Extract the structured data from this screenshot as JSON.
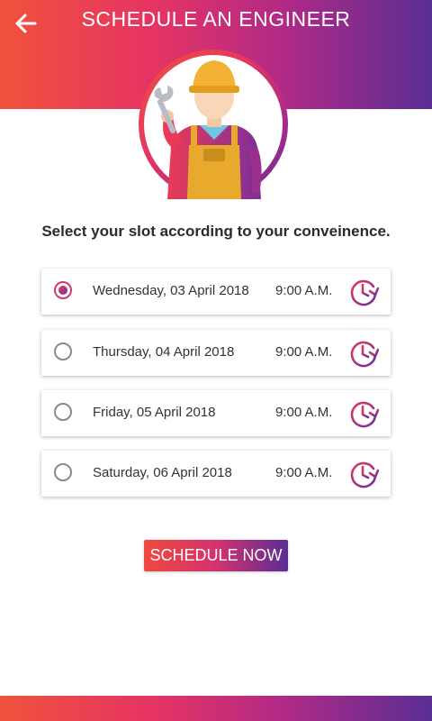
{
  "header": {
    "title": "SCHEDULE AN ENGINEER",
    "back_icon": "arrow-left-icon",
    "gradient": [
      "#f0523c",
      "#e63462",
      "#b22a86",
      "#5a2e94"
    ]
  },
  "avatar": {
    "icon": "engineer-with-wrench-illustration"
  },
  "prompt": "Select your slot according to your conveinence.",
  "slots": [
    {
      "date": "Wednesday, 03 April 2018",
      "time": "9:00 A.M.",
      "selected": true,
      "icon": "clock-refresh-icon"
    },
    {
      "date": "Thursday, 04 April 2018",
      "time": "9:00 A.M.",
      "selected": false,
      "icon": "clock-refresh-icon"
    },
    {
      "date": "Friday, 05 April 2018",
      "time": "9:00 A.M.",
      "selected": false,
      "icon": "clock-refresh-icon"
    },
    {
      "date": "Saturday, 06 April 2018",
      "time": "9:00 A.M.",
      "selected": false,
      "icon": "clock-refresh-icon"
    }
  ],
  "cta": {
    "label": "SCHEDULE NOW"
  },
  "colors": {
    "accent_start": "#ee4a3e",
    "accent_mid": "#d4326e",
    "accent_end": "#5a2e94",
    "text": "#333333"
  }
}
